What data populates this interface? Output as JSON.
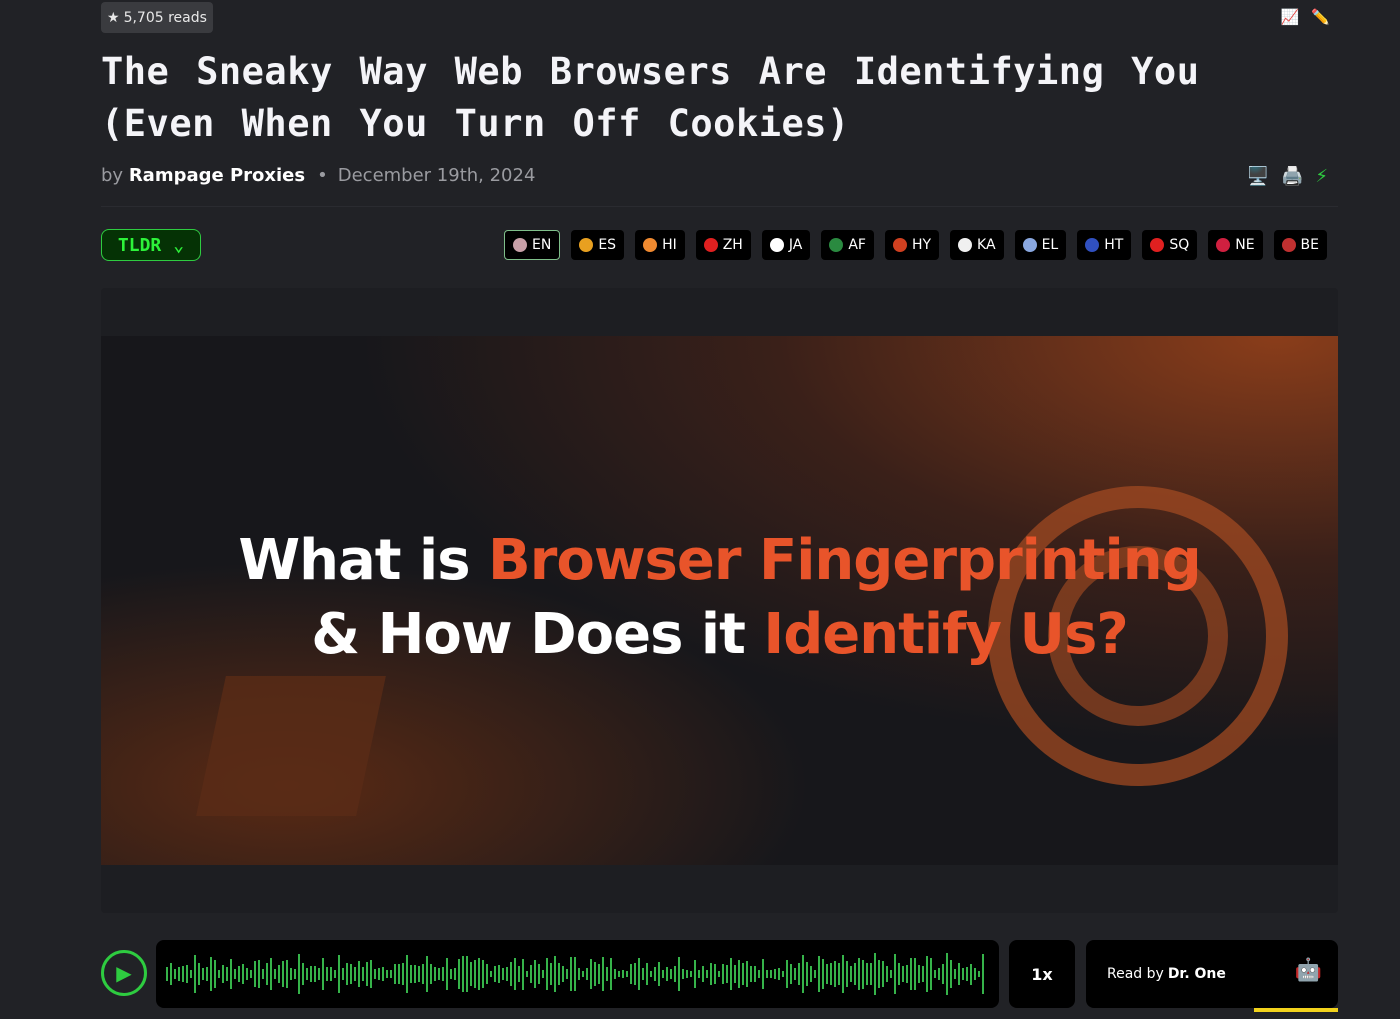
{
  "stats": {
    "reads": "5,705 reads"
  },
  "top_icons": [
    "chart-icon",
    "pencil-icon"
  ],
  "article": {
    "title": "The Sneaky Way Web Browsers Are Identifying You (Even When You Turn Off Cookies)",
    "by": "by",
    "author": "Rampage Proxies",
    "date": "December 19th, 2024"
  },
  "actions": [
    "monitor-icon",
    "printer-icon",
    "lightning-icon"
  ],
  "tldr": {
    "label": "TLDR",
    "chevron": "⌄"
  },
  "languages": [
    {
      "code": "EN",
      "color": "#c8a0a8",
      "active": true
    },
    {
      "code": "ES",
      "color": "#e8a020"
    },
    {
      "code": "HI",
      "color": "#f08a30"
    },
    {
      "code": "ZH",
      "color": "#e02020"
    },
    {
      "code": "JA",
      "color": "#ffffff"
    },
    {
      "code": "AF",
      "color": "#2a8a40"
    },
    {
      "code": "HY",
      "color": "#d04020"
    },
    {
      "code": "KA",
      "color": "#f0f0f0"
    },
    {
      "code": "EL",
      "color": "#8aa8e0"
    },
    {
      "code": "HT",
      "color": "#3050c0"
    },
    {
      "code": "SQ",
      "color": "#e02020"
    },
    {
      "code": "NE",
      "color": "#d02040"
    },
    {
      "code": "BE",
      "color": "#c03030"
    }
  ],
  "hero": {
    "line1_white": "What is ",
    "line1_orange": "Browser Fingerprinting",
    "line2_white": "& How Does it ",
    "line2_orange": "Identify Us?"
  },
  "player": {
    "speed": "1x",
    "read_by": "Read by",
    "reader": "Dr. One",
    "accent": "#2ecc40",
    "progress_color": "#f2d21c"
  }
}
